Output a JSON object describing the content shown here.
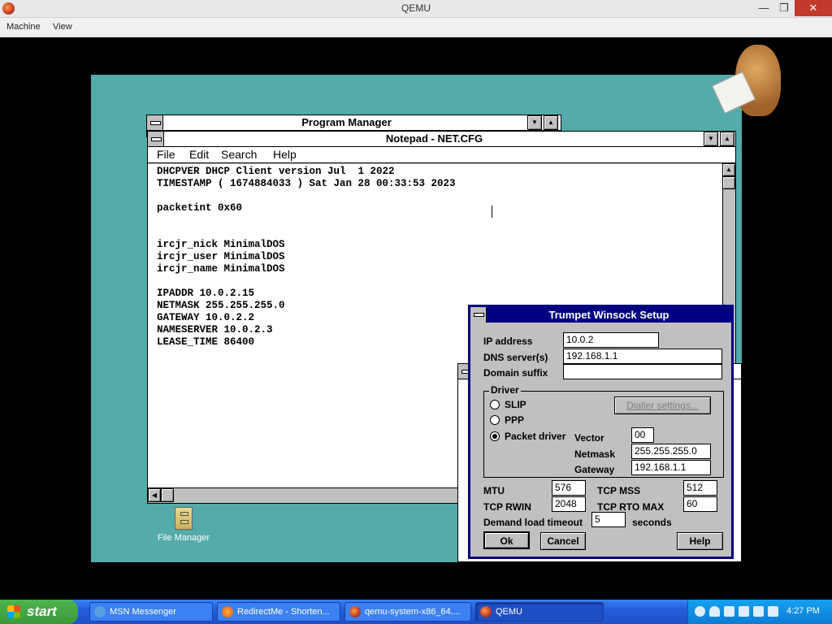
{
  "qemu": {
    "title": "QEMU",
    "menu": [
      "Machine",
      "View"
    ]
  },
  "program_manager": {
    "title": "Program Manager"
  },
  "notepad": {
    "title": "Notepad - NET.CFG",
    "menu": [
      "File",
      "Edit",
      "Search",
      "Help"
    ],
    "text": "DHCPVER DHCP Client version Jul  1 2022\nTIMESTAMP ( 1674884033 ) Sat Jan 28 00:33:53 2023\n\npacketint 0x60\n\n\nircjr_nick MinimalDOS\nircjr_user MinimalDOS\nircjr_name MinimalDOS\n\nIPADDR 10.0.2.15\nNETMASK 255.255.255.0\nGATEWAY 10.0.2.2\nNAMESERVER 10.0.2.3\nLEASE_TIME 86400"
  },
  "trumpet": {
    "title": "Trumpet Winsock Setup",
    "ip_label": "IP address",
    "ip_value": "10.0.2",
    "dns_label": "DNS server(s)",
    "dns_value": "192.168.1.1",
    "domain_label": "Domain suffix",
    "domain_value": "",
    "driver_label": "Driver",
    "slip_label": "SLIP",
    "ppp_label": "PPP",
    "packet_label": "Packet driver",
    "dialler_label": "Dialler settings...",
    "vector_label": "Vector",
    "vector_value": "00",
    "netmask_label": "Netmask",
    "netmask_value": "255.255.255.0",
    "gateway_label": "Gateway",
    "gateway_value": "192.168.1.1",
    "mtu_label": "MTU",
    "mtu_value": "576",
    "mss_label": "TCP MSS",
    "mss_value": "512",
    "rwin_label": "TCP RWIN",
    "rwin_value": "2048",
    "rto_label": "TCP RTO MAX",
    "rto_value": "60",
    "demand_label": "Demand load timeout",
    "demand_value": "5",
    "seconds_label": "seconds",
    "ok_label": "Ok",
    "cancel_label": "Cancel",
    "help_label": "Help"
  },
  "desktop": {
    "file_manager_label": "File Manager"
  },
  "taskbar": {
    "start_label": "start",
    "tasks": [
      "MSN Messenger",
      "RedirectMe - Shorten...",
      "qemu-system-x86_64....",
      "QEMU"
    ],
    "clock": "4:27 PM"
  }
}
